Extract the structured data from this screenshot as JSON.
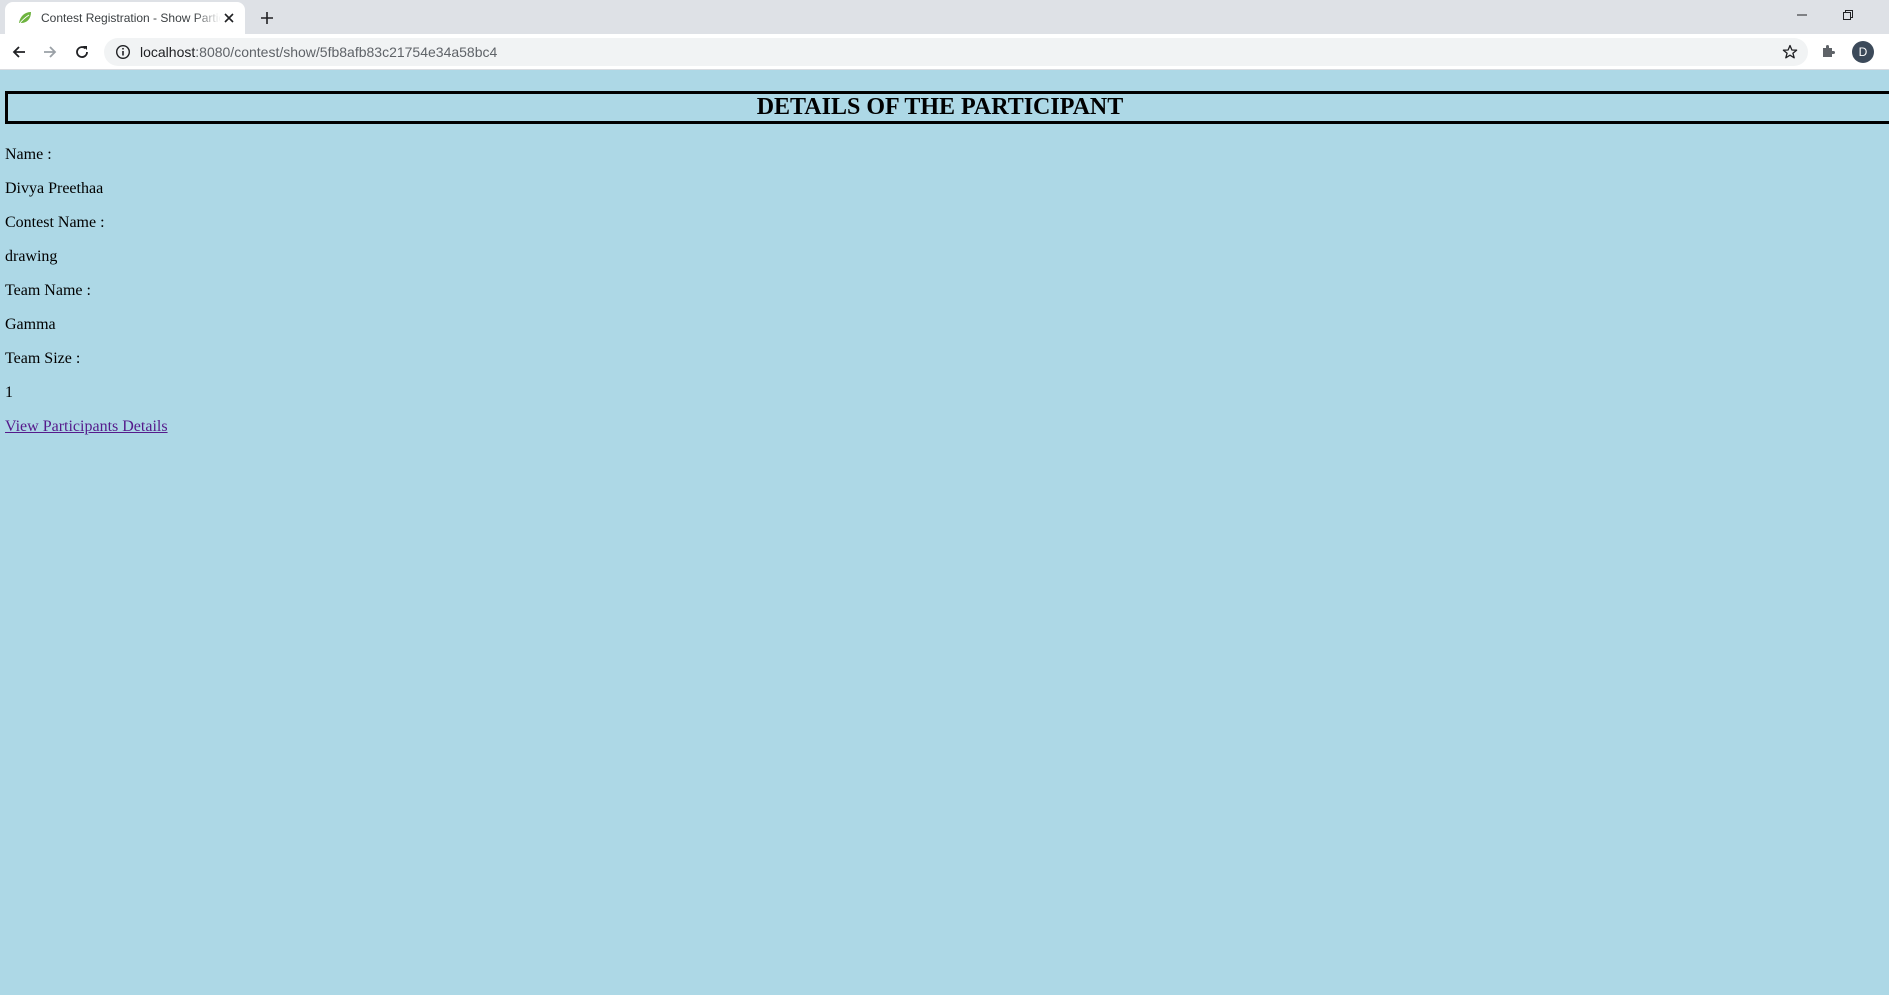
{
  "browser": {
    "tab_title": "Contest Registration - Show Participant",
    "url_host": "localhost",
    "url_path": ":8080/contest/show/5fb8afb83c21754e34a58bc4",
    "profile_initial": "D",
    "favicon_color": "#6db33f"
  },
  "page": {
    "heading": "DETAILS OF THE PARTICIPANT",
    "name_label": "Name :",
    "name_value": "Divya Preethaa",
    "contest_label": "Contest Name :",
    "contest_value": "drawing",
    "team_label": "Team Name :",
    "team_value": "Gamma",
    "size_label": "Team Size :",
    "size_value": "1",
    "link_text": "View Participants Details",
    "background_color": "#add8e6",
    "link_color": "#551a8b"
  }
}
